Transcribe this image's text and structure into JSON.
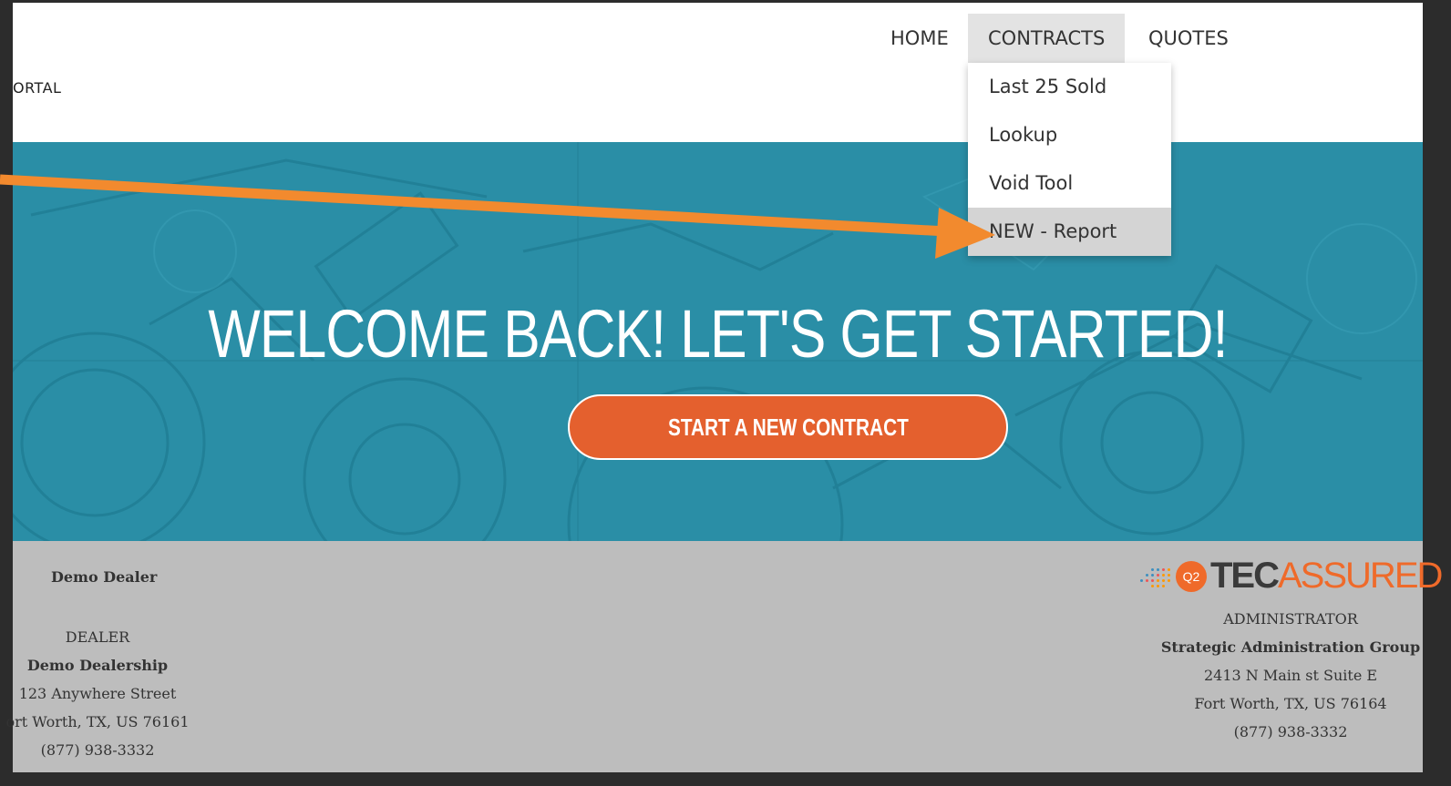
{
  "header": {
    "portal_label": "ORTAL",
    "nav": [
      {
        "label": "HOME"
      },
      {
        "label": "CONTRACTS"
      },
      {
        "label": "QUOTES"
      }
    ],
    "contracts_menu": [
      {
        "label": "Last 25 Sold"
      },
      {
        "label": "Lookup"
      },
      {
        "label": "Void Tool"
      },
      {
        "label": "NEW - Report"
      }
    ]
  },
  "hero": {
    "title": "WELCOME BACK! LET'S GET STARTED!",
    "cta_label": "START A NEW CONTRACT"
  },
  "footer": {
    "dealer": {
      "name": "Demo Dealer",
      "role": "DEALER",
      "company": "Demo Dealership",
      "address": "123 Anywhere Street",
      "city": "ort Worth,  TX,  US 76161",
      "phone": "(877) 938-3332"
    },
    "logo": {
      "badge": "Q2",
      "tec": "TEC",
      "assured": "ASSURED"
    },
    "administrator": {
      "role": "ADMINISTRATOR",
      "company": "Strategic Administration Group",
      "address": "2413 N Main st Suite E",
      "city": "Fort Worth,  TX,  US 76164",
      "phone": "(877) 938-3332"
    }
  },
  "colors": {
    "hero_bg": "#2a8ea6",
    "cta_bg": "#e4602e",
    "footer_bg": "#bdbdbd",
    "annotation_arrow": "#f28a2e",
    "brand_orange": "#ef6a2a"
  }
}
